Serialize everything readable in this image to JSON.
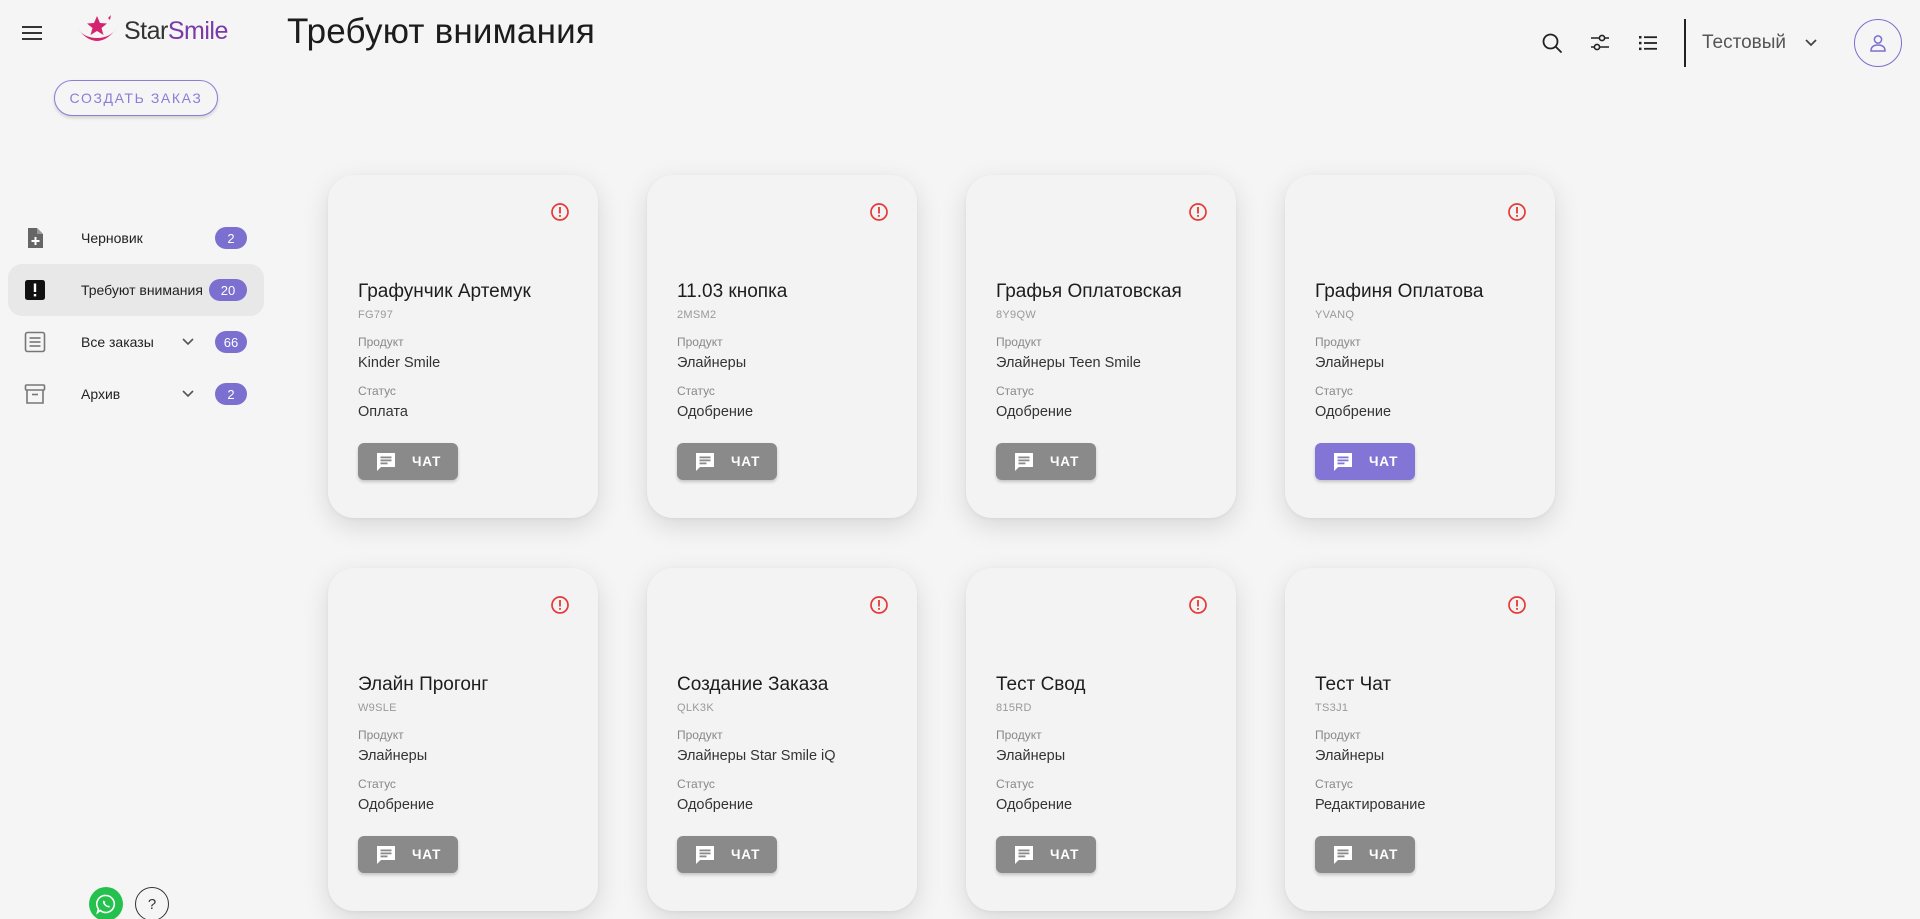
{
  "header": {
    "logo_star": "Star",
    "logo_smile": "Smile",
    "title": "Требуют внимания",
    "account_name": "Тестовый"
  },
  "sidebar": {
    "create_button": "СОЗДАТЬ ЗАКАЗ",
    "items": [
      {
        "label": "Черновик",
        "count": "2"
      },
      {
        "label": "Требуют внимания",
        "count": "20"
      },
      {
        "label": "Все заказы",
        "count": "66"
      },
      {
        "label": "Архив",
        "count": "2"
      }
    ],
    "help_label": "?"
  },
  "cards": [
    {
      "name": "Графунчик Артемук",
      "code": "FG797",
      "product_label": "Продукт",
      "product": "Kinder Smile",
      "status_label": "Статус",
      "status": "Оплата",
      "chat_label": "ЧАТ",
      "chat_highlighted": false
    },
    {
      "name": "11.03 кнопка",
      "code": "2MSM2",
      "product_label": "Продукт",
      "product": "Элайнеры",
      "status_label": "Статус",
      "status": "Одобрение",
      "chat_label": "ЧАТ",
      "chat_highlighted": false
    },
    {
      "name": "Графья Оплатовская",
      "code": "8Y9QW",
      "product_label": "Продукт",
      "product": "Элайнеры Teen Smile",
      "status_label": "Статус",
      "status": "Одобрение",
      "chat_label": "ЧАТ",
      "chat_highlighted": false
    },
    {
      "name": "Графиня Оплатова",
      "code": "YVANQ",
      "product_label": "Продукт",
      "product": "Элайнеры",
      "status_label": "Статус",
      "status": "Одобрение",
      "chat_label": "ЧАТ",
      "chat_highlighted": true
    },
    {
      "name": "Элайн Прогонг",
      "code": "W9SLE",
      "product_label": "Продукт",
      "product": "Элайнеры",
      "status_label": "Статус",
      "status": "Одобрение",
      "chat_label": "ЧАТ",
      "chat_highlighted": false
    },
    {
      "name": "Создание Заказа",
      "code": "QLK3K",
      "product_label": "Продукт",
      "product": "Элайнеры Star Smile iQ",
      "status_label": "Статус",
      "status": "Одобрение",
      "chat_label": "ЧАТ",
      "chat_highlighted": false
    },
    {
      "name": "Тест Свод",
      "code": "815RD",
      "product_label": "Продукт",
      "product": "Элайнеры",
      "status_label": "Статус",
      "status": "Одобрение",
      "chat_label": "ЧАТ",
      "chat_highlighted": false
    },
    {
      "name": "Тест Чат",
      "code": "TS3J1",
      "product_label": "Продукт",
      "product": "Элайнеры",
      "status_label": "Статус",
      "status": "Редактирование",
      "chat_label": "ЧАТ",
      "chat_highlighted": false
    }
  ],
  "colors": {
    "accent": "#7b6fcf",
    "logo_pink": "#d4246e",
    "alert": "#e53935",
    "chat_button": "#8a8a8a",
    "whatsapp": "#25c14f"
  }
}
